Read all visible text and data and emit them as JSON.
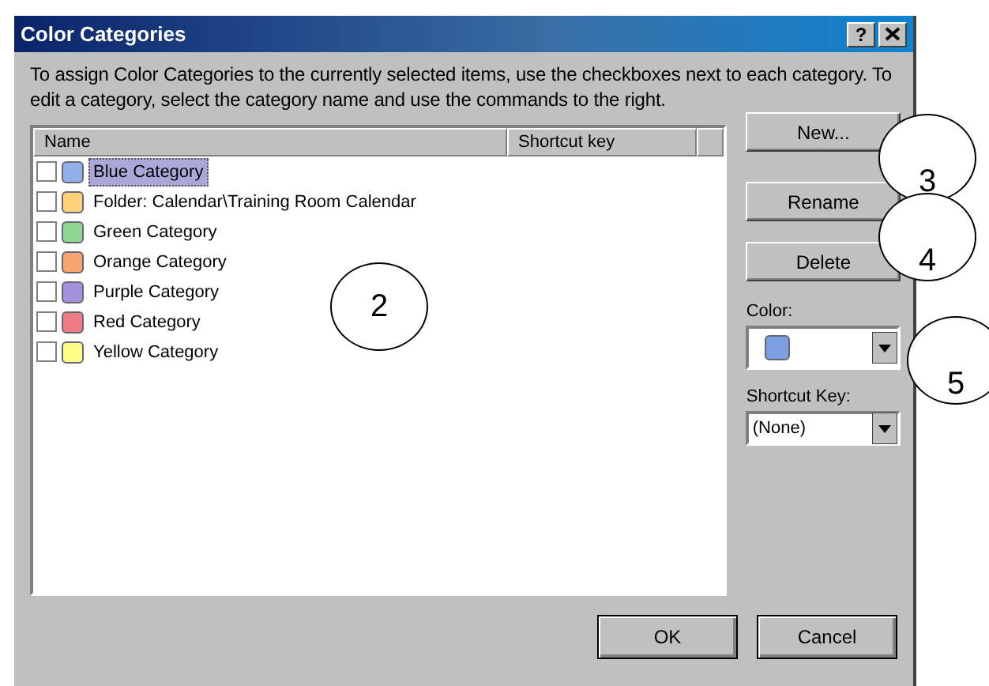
{
  "window": {
    "title": "Color Categories",
    "help": "?"
  },
  "description": "To assign Color Categories to the currently selected items, use the checkboxes next to each category.  To edit a category, select the category name and use the commands to the right.",
  "columns": [
    "Name",
    "Shortcut key"
  ],
  "rows": [
    {
      "name": "Blue Category",
      "checked": false,
      "selected": true,
      "color": "#8fb0e8"
    },
    {
      "name": "Folder: Calendar\\Training Room Calendar",
      "checked": false,
      "selected": false,
      "color": "#ffd27a"
    },
    {
      "name": "Green Category",
      "checked": false,
      "selected": false,
      "color": "#90d890"
    },
    {
      "name": "Orange Category",
      "checked": false,
      "selected": false,
      "color": "#f6a472"
    },
    {
      "name": "Purple Category",
      "checked": false,
      "selected": false,
      "color": "#a491dc"
    },
    {
      "name": "Red Category",
      "checked": false,
      "selected": false,
      "color": "#ee7c80"
    },
    {
      "name": "Yellow Category",
      "checked": false,
      "selected": false,
      "color": "#ffff88"
    }
  ],
  "side_buttons": [
    "New...",
    "Rename",
    "Delete"
  ],
  "color_field": {
    "label": "Color:",
    "color": "#7b9fe0"
  },
  "shortcut_field": {
    "label": "Shortcut Key:",
    "value": "(None)"
  },
  "buttons": [
    "OK",
    "Cancel"
  ],
  "callouts": [
    "2",
    "3",
    "4",
    "5"
  ]
}
